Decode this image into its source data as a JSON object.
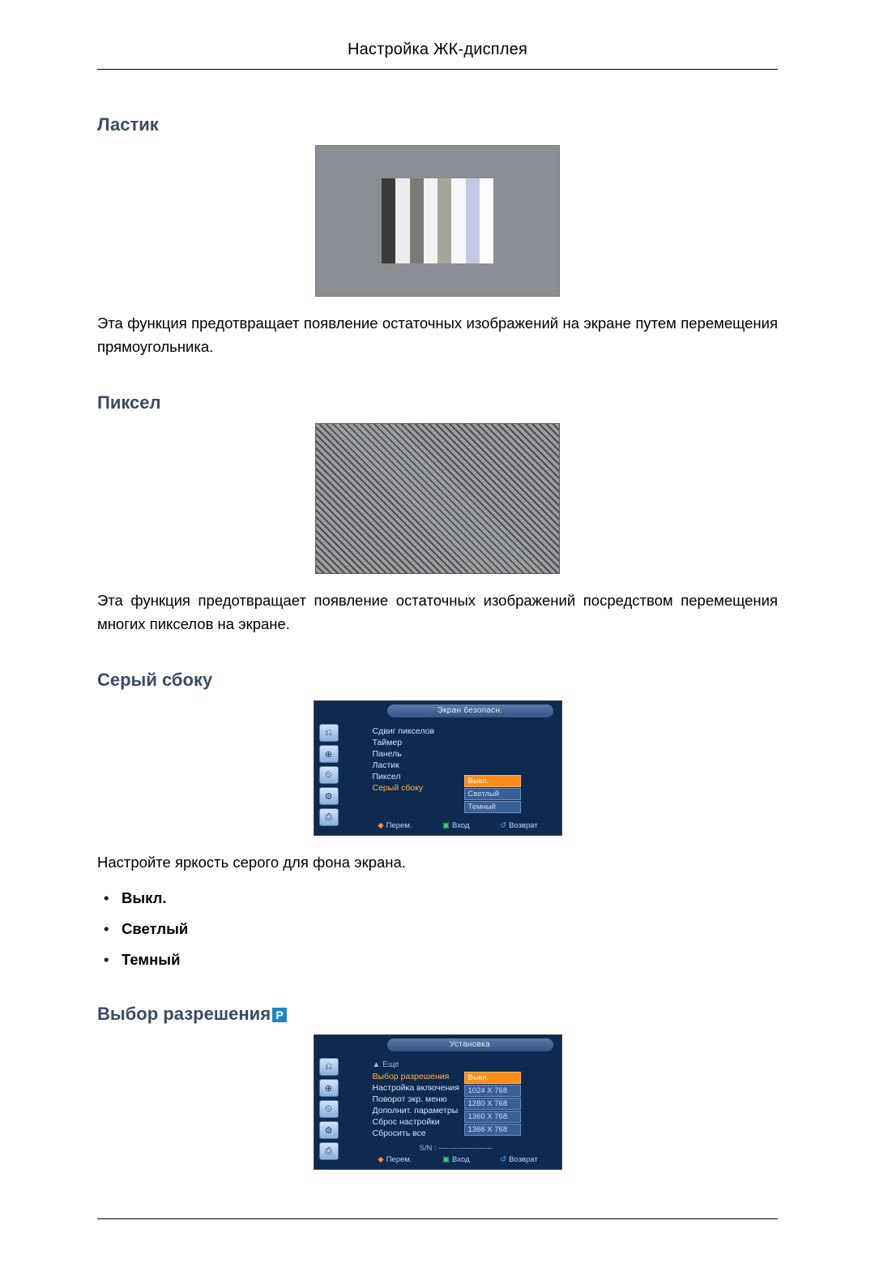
{
  "header": {
    "title": "Настройка ЖК-дисплея"
  },
  "section1": {
    "heading": "Ластик",
    "bars_colors": [
      "#3b3b3b",
      "#ececec",
      "#7a7c73",
      "#f2f2f2",
      "#a5a59a",
      "#f7f7f7",
      "#c1c9e4",
      "#fbfbfb"
    ],
    "text": "Эта функция предотвращает появление остаточных изображений на экране путем перемещения прямоугольника."
  },
  "section2": {
    "heading": "Пиксел",
    "text": "Эта функция предотвращает появление остаточных изображений посредством перемещения многих пикселов на экране."
  },
  "section3": {
    "heading": "Серый сбоку",
    "intro": "Настройте яркость серого для фона экрана.",
    "options": [
      "Выкл.",
      "Светлый",
      "Темный"
    ],
    "osd": {
      "title": "Экран безопасн.",
      "icons": [
        "⎌",
        "⊕",
        "⏲",
        "⚙",
        "⎙"
      ],
      "menu": [
        {
          "label": "Сдвиг пикселов",
          "hl": false
        },
        {
          "label": "Таймер",
          "hl": false
        },
        {
          "label": "Панель",
          "hl": false
        },
        {
          "label": "Ластик",
          "hl": false
        },
        {
          "label": "Пиксел",
          "hl": false
        },
        {
          "label": "Серый сбоку",
          "hl": true
        }
      ],
      "values": [
        {
          "label": "Выкл.",
          "sel": true
        },
        {
          "label": "Светлый",
          "sel": false
        },
        {
          "label": "Темный",
          "sel": false
        }
      ],
      "footer": {
        "move": "Перем.",
        "enter": "Вход",
        "return": "Возврат"
      }
    }
  },
  "section4": {
    "heading": "Выбор разрешения",
    "badge": "P",
    "osd": {
      "title": "Установка",
      "icons": [
        "⎌",
        "⊕",
        "⏲",
        "⚙",
        "⎙"
      ],
      "more": "▲ Еще",
      "menu": [
        {
          "label": "Выбор разрешения",
          "hl": true
        },
        {
          "label": "Настройка включения",
          "hl": false
        },
        {
          "label": "Поворот экр. меню",
          "hl": false
        },
        {
          "label": "Дополнит. параметры",
          "hl": false
        },
        {
          "label": "Сброс настройки",
          "hl": false
        },
        {
          "label": "Сбросить все",
          "hl": false
        }
      ],
      "values": [
        {
          "label": "Выкл.",
          "sel": true
        },
        {
          "label": "1024 X 768",
          "sel": false
        },
        {
          "label": "1280 X 768",
          "sel": false
        },
        {
          "label": "1360 X 768",
          "sel": false
        },
        {
          "label": "1366 X 768",
          "sel": false
        }
      ],
      "sn": "S/N : ---------------------",
      "footer": {
        "move": "Перем.",
        "enter": "Вход",
        "return": "Возврат"
      }
    }
  }
}
